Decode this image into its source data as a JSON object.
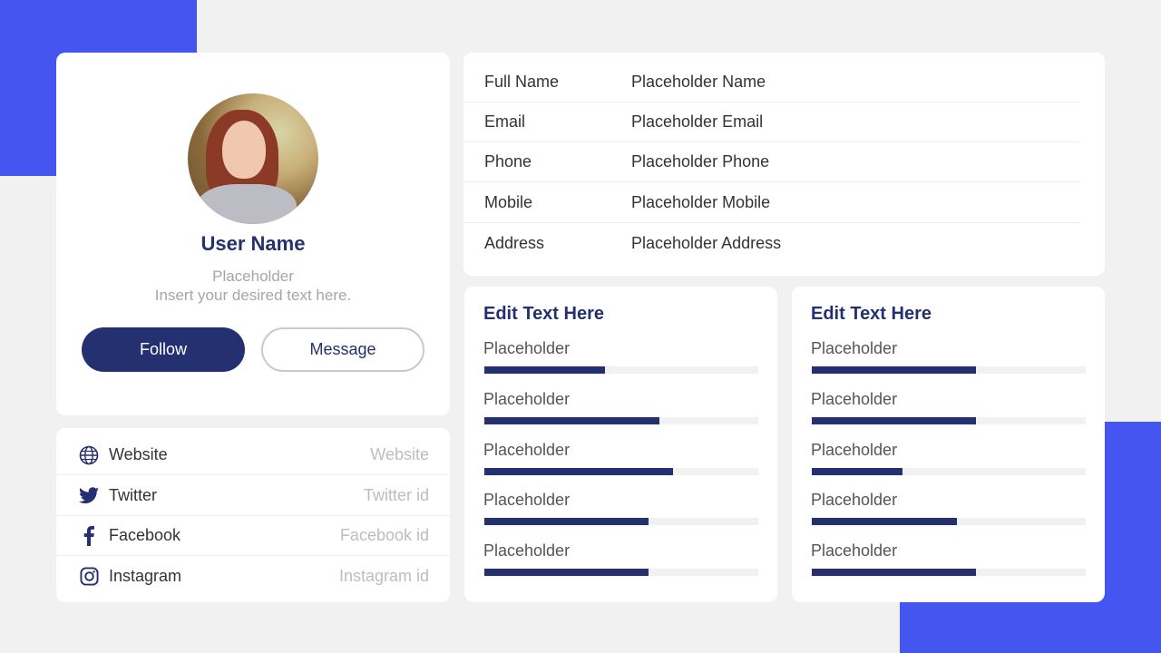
{
  "profile": {
    "user_name": "User Name",
    "subtitle_line1": "Placeholder",
    "subtitle_line2": "Insert your desired text here.",
    "follow_label": "Follow",
    "message_label": "Message"
  },
  "social": [
    {
      "label": "Website",
      "value": "Website",
      "icon": "globe-icon"
    },
    {
      "label": "Twitter",
      "value": "Twitter  id",
      "icon": "twitter-icon"
    },
    {
      "label": "Facebook",
      "value": "Facebook id",
      "icon": "facebook-icon"
    },
    {
      "label": "Instagram",
      "value": "Instagram id",
      "icon": "instagram-icon"
    }
  ],
  "info": [
    {
      "label": "Full Name",
      "value": "Placeholder Name"
    },
    {
      "label": "Email",
      "value": "Placeholder Email"
    },
    {
      "label": "Phone",
      "value": "Placeholder Phone"
    },
    {
      "label": "Mobile",
      "value": "Placeholder Mobile"
    },
    {
      "label": "Address",
      "value": "Placeholder Address"
    }
  ],
  "skills_left": {
    "title": "Edit Text Here",
    "items": [
      {
        "label": "Placeholder",
        "level": 0.44
      },
      {
        "label": "Placeholder",
        "level": 0.64
      },
      {
        "label": "Placeholder",
        "level": 0.69
      },
      {
        "label": "Placeholder",
        "level": 0.6
      },
      {
        "label": "Placeholder",
        "level": 0.6
      }
    ]
  },
  "skills_right": {
    "title": "Edit Text Here",
    "items": [
      {
        "label": "Placeholder",
        "level": 0.6
      },
      {
        "label": "Placeholder",
        "level": 0.6
      },
      {
        "label": "Placeholder",
        "level": 0.33
      },
      {
        "label": "Placeholder",
        "level": 0.53
      },
      {
        "label": "Placeholder",
        "level": 0.6
      }
    ]
  },
  "colors": {
    "accent": "#4556f0",
    "navy": "#253070",
    "background": "#f1f1f1"
  }
}
